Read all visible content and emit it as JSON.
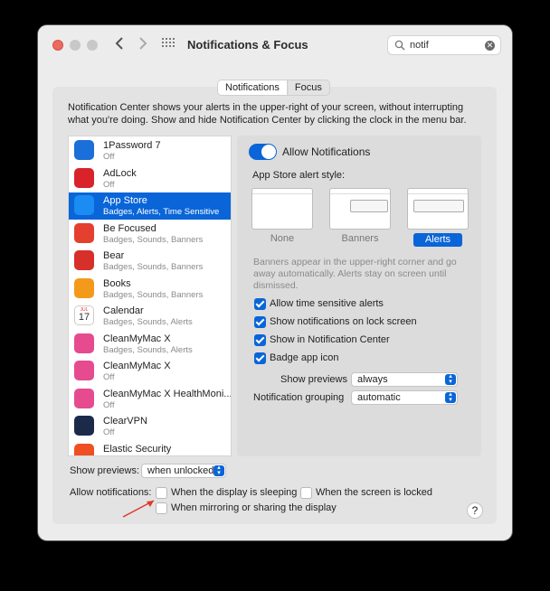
{
  "window": {
    "title": "Notifications & Focus",
    "search": {
      "value": "notif"
    }
  },
  "tabs": [
    {
      "label": "Notifications",
      "active": true
    },
    {
      "label": "Focus",
      "active": false
    }
  ],
  "description": "Notification Center shows your alerts in the upper-right of your screen, without interrupting what you're doing. Show and hide Notification Center by clicking the clock in the menu bar.",
  "apps": [
    {
      "name": "1Password 7",
      "status": "Off",
      "icon_color": "#1a6fd8",
      "icon": "1password-icon"
    },
    {
      "name": "AdLock",
      "status": "Off",
      "icon_color": "#d8232a",
      "icon": "adlock-icon"
    },
    {
      "name": "App Store",
      "status": "Badges, Alerts, Time Sensitive",
      "icon_color": "#1b8cf2",
      "icon": "app-store-icon",
      "selected": true
    },
    {
      "name": "Be Focused",
      "status": "Badges, Sounds, Banners",
      "icon_color": "#e5402f",
      "icon": "be-focused-icon"
    },
    {
      "name": "Bear",
      "status": "Badges, Sounds, Banners",
      "icon_color": "#d7302a",
      "icon": "bear-icon"
    },
    {
      "name": "Books",
      "status": "Badges, Sounds, Banners",
      "icon_color": "#f39a1b",
      "icon": "books-icon"
    },
    {
      "name": "Calendar",
      "status": "Badges, Sounds, Alerts",
      "icon_color": "#ffffff",
      "icon": "calendar-icon",
      "calendar_day": "17",
      "calendar_month": "JUL"
    },
    {
      "name": "CleanMyMac X",
      "status": "Badges, Sounds, Alerts",
      "icon_color": "#e64a8f",
      "icon": "cleanmymac-icon"
    },
    {
      "name": "CleanMyMac X",
      "status": "Off",
      "icon_color": "#e64a8f",
      "icon": "cleanmymac-icon"
    },
    {
      "name": "CleanMyMac X HealthMoni...",
      "status": "Off",
      "icon_color": "#e64a8f",
      "icon": "cleanmymac-health-icon"
    },
    {
      "name": "ClearVPN",
      "status": "Off",
      "icon_color": "#1c2a4a",
      "icon": "clearvpn-icon"
    },
    {
      "name": "Elastic Security",
      "status": "",
      "icon_color": "#f04e23",
      "icon": "elastic-security-icon"
    }
  ],
  "detail": {
    "allow_notifications": {
      "label": "Allow Notifications",
      "on": true
    },
    "alert_style_label": "App Store alert style:",
    "styles": [
      {
        "label": "None"
      },
      {
        "label": "Banners"
      },
      {
        "label": "Alerts",
        "selected": true
      }
    ],
    "note": "Banners appear in the upper-right corner and go away automatically. Alerts stay on screen until dismissed.",
    "checkboxes": [
      {
        "label": "Allow time sensitive alerts",
        "checked": true
      },
      {
        "label": "Show notifications on lock screen",
        "checked": true
      },
      {
        "label": "Show in Notification Center",
        "checked": true
      },
      {
        "label": "Badge app icon",
        "checked": true
      }
    ],
    "show_previews": {
      "label": "Show previews",
      "value": "always"
    },
    "grouping": {
      "label": "Notification grouping",
      "value": "automatic"
    }
  },
  "bottom": {
    "show_previews": {
      "label": "Show previews:",
      "value": "when unlocked"
    },
    "allow_label": "Allow notifications:",
    "options": [
      {
        "label": "When the display is sleeping",
        "checked": false
      },
      {
        "label": "When the screen is locked",
        "checked": false
      },
      {
        "label": "When mirroring or sharing the display",
        "checked": false
      }
    ]
  },
  "help": "?",
  "accent_color": "#0a65d8",
  "annotation_arrow_color": "#e0392b"
}
